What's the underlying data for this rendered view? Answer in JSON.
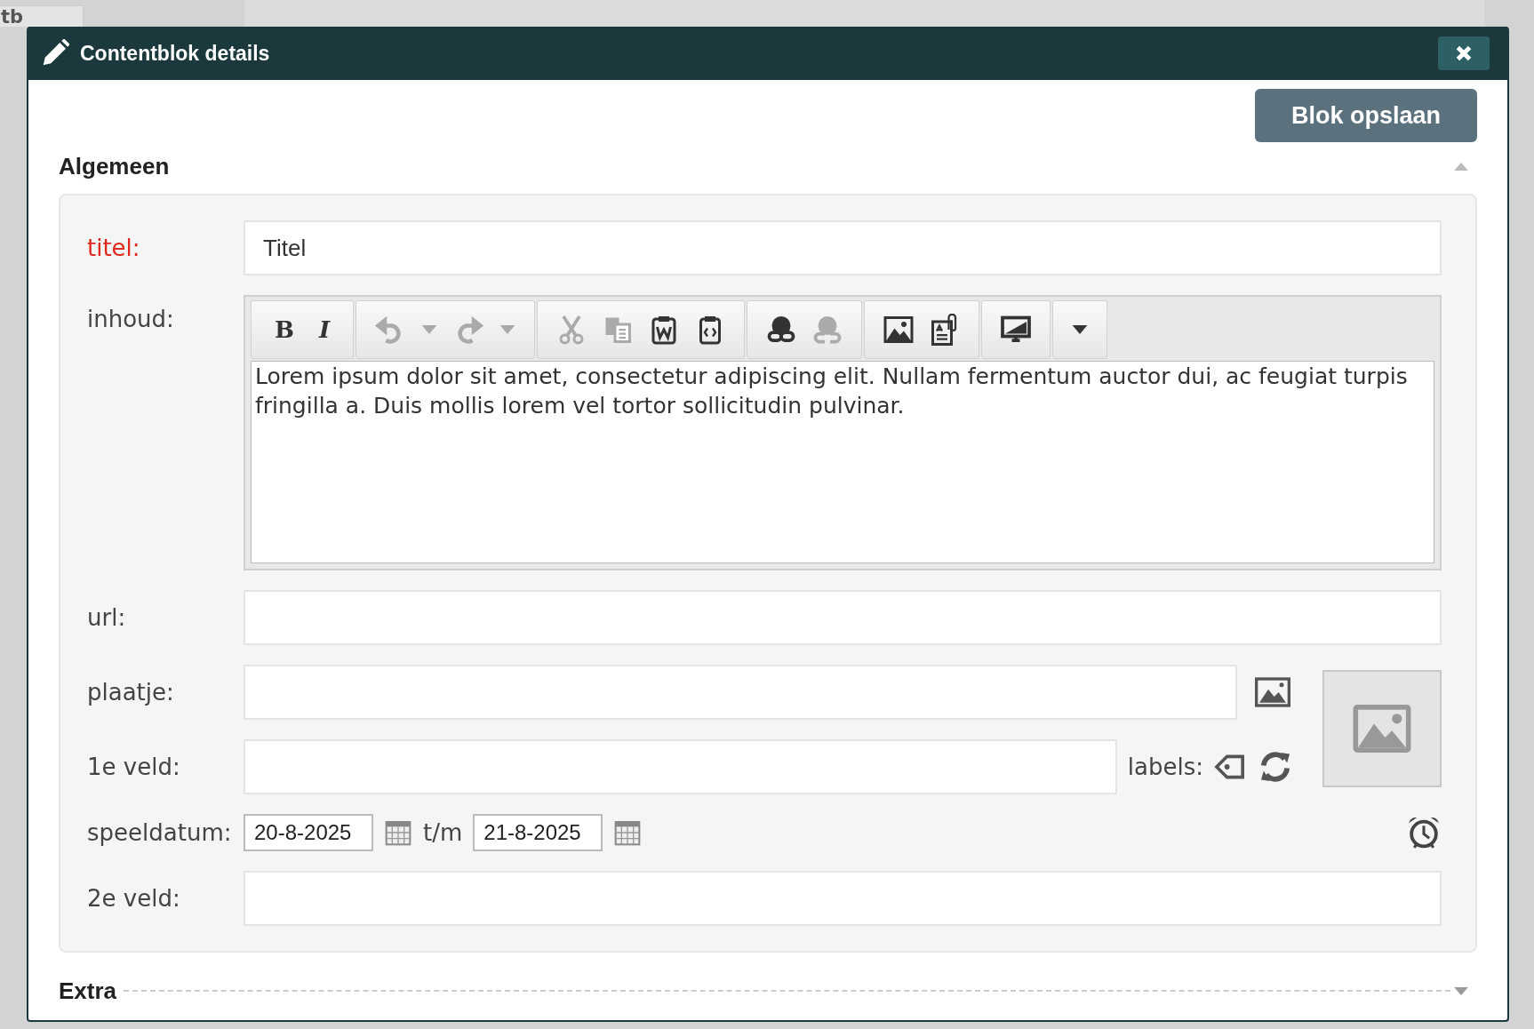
{
  "background": {
    "tab_label": "tb"
  },
  "dialog": {
    "title": "Contentblok details",
    "save_button": "Blok opslaan"
  },
  "sections": [
    {
      "title": "Algemeen",
      "expanded": true
    },
    {
      "title": "Extra",
      "expanded": false
    }
  ],
  "fields": {
    "titel": {
      "label": "titel:",
      "required": true,
      "value": "Titel"
    },
    "inhoud": {
      "label": "inhoud:",
      "required": false,
      "text": "Lorem ipsum dolor sit amet, consectetur adipiscing elit. Nullam fermentum auctor dui, ac feugiat turpis fringilla a. Duis mollis lorem vel tortor sollicitudin pulvinar.",
      "toolbar": [
        [
          {
            "kind": "bold",
            "text": "B",
            "disabled": false
          },
          {
            "kind": "italic",
            "text": "I",
            "disabled": false
          }
        ],
        [
          {
            "kind": "undo",
            "disabled": true
          },
          {
            "kind": "dropdown",
            "disabled": true
          },
          {
            "kind": "redo",
            "disabled": true
          },
          {
            "kind": "dropdown",
            "disabled": true
          }
        ],
        [
          {
            "kind": "cut",
            "disabled": true
          },
          {
            "kind": "copy",
            "disabled": true
          },
          {
            "kind": "paste-word",
            "disabled": false
          },
          {
            "kind": "paste-code",
            "disabled": false
          }
        ],
        [
          {
            "kind": "link",
            "disabled": false
          },
          {
            "kind": "unlink",
            "disabled": true
          }
        ],
        [
          {
            "kind": "image",
            "disabled": false
          },
          {
            "kind": "attachment",
            "disabled": false
          }
        ],
        [
          {
            "kind": "media",
            "disabled": false
          }
        ],
        [
          {
            "kind": "more",
            "disabled": false
          }
        ]
      ]
    },
    "url": {
      "label": "url:",
      "required": false
    },
    "plaatje": {
      "label": "plaatje:",
      "required": false
    },
    "veld1": {
      "label": "1e veld:",
      "required": false,
      "labels_label": "labels:"
    },
    "speeldatum": {
      "label": "speeldatum:",
      "required": false,
      "from": "20-8-2025",
      "to_label": "t/m",
      "to": "21-8-2025"
    },
    "veld2": {
      "label": "2e veld:",
      "required": false
    }
  }
}
